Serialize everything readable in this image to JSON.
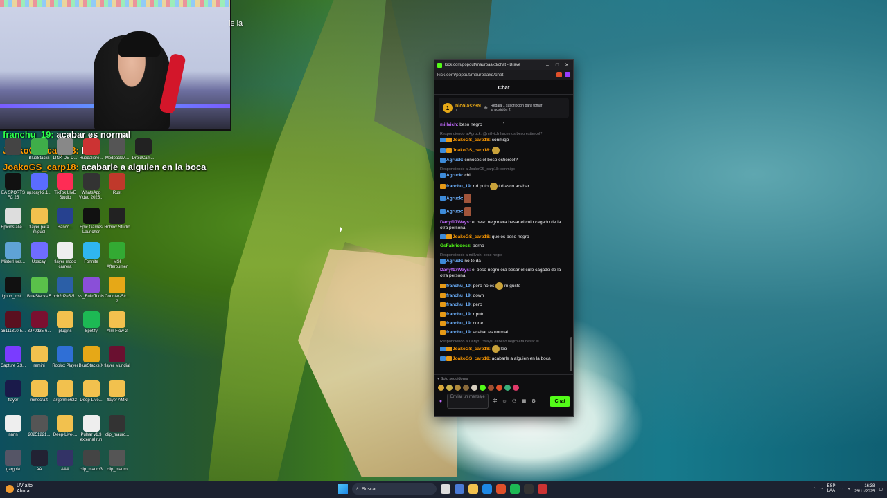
{
  "webcam": {
    "caption_fragment": "le la"
  },
  "overlay_chat": [
    {
      "user": "franchu_19:",
      "text": "acabar es normal",
      "user_color": "#2dff4b"
    },
    {
      "user": "JoakoGS_carp18:",
      "text": "leo",
      "user_color": "#ff9a00"
    },
    {
      "user": "JoakoGS_carp18:",
      "text": "acabarle a alguien en la boca",
      "user_color": "#ff9a00"
    }
  ],
  "desktop_icons": [
    {
      "label": "",
      "icon": "app-icon",
      "color": "#444"
    },
    {
      "label": "BlueStacks",
      "icon": "bluestacks-icon",
      "color": "#3fae49"
    },
    {
      "label": "LINK-DE-D...",
      "icon": "file-icon",
      "color": "#888"
    },
    {
      "label": "Ruedalibre...",
      "icon": "app-icon",
      "color": "#c33"
    },
    {
      "label": "ModpackM...",
      "icon": "app-icon",
      "color": "#555"
    },
    {
      "label": "DroidCam...",
      "icon": "droidcam-icon",
      "color": "#222"
    },
    {
      "label": "EA SPORTS FC 25",
      "icon": "ea-icon",
      "color": "#111"
    },
    {
      "label": "upscayl-2.1...",
      "icon": "upscayl-icon",
      "color": "#5a6cff"
    },
    {
      "label": "TikTok LIVE Studio",
      "icon": "tiktok-icon",
      "color": "#fe2c55"
    },
    {
      "label": "WhatsApp Video 2025...",
      "icon": "video-icon",
      "color": "#333"
    },
    {
      "label": "Rust",
      "icon": "rust-icon",
      "color": "#c0392b"
    },
    {
      "label": "Epicinstalle...",
      "icon": "installer-icon",
      "color": "#ddd"
    },
    {
      "label": "flayer para miguel",
      "icon": "folder-icon",
      "color": "#f2c14e"
    },
    {
      "label": "Banco...",
      "icon": "app-icon",
      "color": "#26418f"
    },
    {
      "label": "Epic Games Launcher",
      "icon": "epic-icon",
      "color": "#111"
    },
    {
      "label": "Roblox Studio",
      "icon": "roblox-icon",
      "color": "#222"
    },
    {
      "label": "MisterHors...",
      "icon": "app-icon",
      "color": "#5fa3d6"
    },
    {
      "label": "Upscayl",
      "icon": "upscayl-icon",
      "color": "#6f6cff"
    },
    {
      "label": "flayer modo carrera",
      "icon": "file-icon",
      "color": "#eee"
    },
    {
      "label": "Fortnite",
      "icon": "fortnite-icon",
      "color": "#2fb6f0"
    },
    {
      "label": "MSI Afterburner",
      "icon": "msi-icon",
      "color": "#3a3"
    },
    {
      "label": "lghub_inst...",
      "icon": "logitech-icon",
      "color": "#111"
    },
    {
      "label": "BlueStacks 5",
      "icon": "bluestacks-icon",
      "color": "#5ac14a"
    },
    {
      "label": "bcb2d2e5-5...",
      "icon": "app-icon",
      "color": "#2b5fa7"
    },
    {
      "label": "vs_BuildTools",
      "icon": "vs-icon",
      "color": "#8a4fd8"
    },
    {
      "label": "Counter-Str... 2",
      "icon": "cs-icon",
      "color": "#e6a817"
    },
    {
      "label": "a6111310-5...",
      "icon": "app-icon",
      "color": "#5a1020"
    },
    {
      "label": "3970d35-6...",
      "icon": "app-icon",
      "color": "#7a1030"
    },
    {
      "label": "plugins",
      "icon": "folder-icon",
      "color": "#f2c14e"
    },
    {
      "label": "Spotify",
      "icon": "spotify-icon",
      "color": "#1db954"
    },
    {
      "label": "Alm Flow 2",
      "icon": "folder-icon",
      "color": "#f2c14e"
    },
    {
      "label": "Capture 5.3...",
      "icon": "capture-icon",
      "color": "#7a3cff"
    },
    {
      "label": "remini",
      "icon": "folder-icon",
      "color": "#f2c14e"
    },
    {
      "label": "Roblox Player",
      "icon": "roblox-icon",
      "color": "#2f6fd6"
    },
    {
      "label": "BlueStacks X",
      "icon": "bluestacks-icon",
      "color": "#e6a817"
    },
    {
      "label": "flayer Mundial",
      "icon": "app-icon",
      "color": "#6a1030"
    },
    {
      "label": "flayer",
      "icon": "ae-icon",
      "color": "#1a1a4a"
    },
    {
      "label": "minecraft",
      "icon": "folder-icon",
      "color": "#f2c14e"
    },
    {
      "label": "argenmo622",
      "icon": "folder-icon",
      "color": "#f2c14e"
    },
    {
      "label": "Deep-Live...",
      "icon": "folder-icon",
      "color": "#f2c14e"
    },
    {
      "label": "flayer AMN",
      "icon": "folder-icon",
      "color": "#f2c14e"
    },
    {
      "label": "nnnn",
      "icon": "file-icon",
      "color": "#eee"
    },
    {
      "label": "20251221...",
      "icon": "app-icon",
      "color": "#555"
    },
    {
      "label": "Deep-Live-...",
      "icon": "folder-icon",
      "color": "#f2c14e"
    },
    {
      "label": "Pulsar v1.3 external run",
      "icon": "file-icon",
      "color": "#eee"
    },
    {
      "label": "clip_mauro...",
      "icon": "app-icon",
      "color": "#333"
    },
    {
      "label": "gargola",
      "icon": "app-icon",
      "color": "#556"
    },
    {
      "label": "AA",
      "icon": "app-icon",
      "color": "#223"
    },
    {
      "label": "AAA",
      "icon": "app-icon",
      "color": "#336"
    },
    {
      "label": "clip_mauro3",
      "icon": "app-icon",
      "color": "#444"
    },
    {
      "label": "clip_mauro",
      "icon": "app-icon",
      "color": "#555"
    }
  ],
  "chat_window": {
    "title": "kick.com/popout/mauroaakd/chat - Brave",
    "url": "kick.com/popout/mauroaakd/chat",
    "header": "Chat",
    "pinned": {
      "user": "nicolas23N",
      "sub": "1",
      "rank": "1",
      "gift_text": "Regala 1 suscripción para tomar la posición 2"
    },
    "messages": [
      {
        "reply": "",
        "user": "millvich:",
        "color": "#c36bff",
        "badges": [],
        "text": "beso negro"
      },
      {
        "reply": "Respondiendo a Agruck: @millvich hacemos beso estiercol?",
        "user": "JoakoGS_carp18:",
        "color": "#ff9a00",
        "badges": [
          "b",
          "o"
        ],
        "text": "conmigo"
      },
      {
        "reply": "",
        "user": "JoakoGS_carp18:",
        "color": "#ff9a00",
        "badges": [
          "b",
          "o"
        ],
        "text": "",
        "emote": "emote"
      },
      {
        "reply": "",
        "user": "Agruck:",
        "color": "#6fb3ff",
        "badges": [
          "b"
        ],
        "text": "conoces el beso estiercol?"
      },
      {
        "reply": "Respondiendo a JoakoGS_carp18: conmigo",
        "user": "Agruck:",
        "color": "#6fb3ff",
        "badges": [
          "b"
        ],
        "text": "chi"
      },
      {
        "reply": "",
        "user": "franchu_19:",
        "color": "#6fb3ff",
        "badges": [
          "o"
        ],
        "text": "r d puto",
        "emote": "emote",
        "text2": "t d asco acabar"
      },
      {
        "reply": "",
        "user": "Agruck:",
        "color": "#6fb3ff",
        "badges": [
          "b"
        ],
        "text": "",
        "emote": "big"
      },
      {
        "reply": "",
        "user": "Agruck:",
        "color": "#6fb3ff",
        "badges": [
          "b"
        ],
        "text": "",
        "emote": "big"
      },
      {
        "reply": "",
        "user": "Danyf17Ways:",
        "color": "#c36bff",
        "badges": [],
        "text": "el beso negro era besar el culo cagado de la otra persona"
      },
      {
        "reply": "",
        "user": "JoakoGS_carp18:",
        "color": "#ff9a00",
        "badges": [
          "b",
          "o"
        ],
        "text": "que es beso negro"
      },
      {
        "reply": "",
        "user": "GsFabricoosz:",
        "color": "#53fc18",
        "badges": [],
        "text": "porno"
      },
      {
        "reply": "Respondiendo a millvich: beso negro",
        "user": "Agruck:",
        "color": "#6fb3ff",
        "badges": [
          "b"
        ],
        "text": "no te da"
      },
      {
        "reply": "",
        "user": "Danyf17Ways:",
        "color": "#c36bff",
        "badges": [],
        "text": "el beso negro era besar el culo cagado de la otra persona"
      },
      {
        "reply": "",
        "user": "franchu_19:",
        "color": "#6fb3ff",
        "badges": [
          "o"
        ],
        "text": "pero no es",
        "emote": "emote",
        "text2": "m guste"
      },
      {
        "reply": "",
        "user": "franchu_19:",
        "color": "#6fb3ff",
        "badges": [
          "o"
        ],
        "text": "down"
      },
      {
        "reply": "",
        "user": "franchu_19:",
        "color": "#6fb3ff",
        "badges": [
          "o"
        ],
        "text": "pero"
      },
      {
        "reply": "",
        "user": "franchu_19:",
        "color": "#6fb3ff",
        "badges": [
          "o"
        ],
        "text": "r puto"
      },
      {
        "reply": "",
        "user": "franchu_19:",
        "color": "#6fb3ff",
        "badges": [
          "o"
        ],
        "text": "corte"
      },
      {
        "reply": "",
        "user": "franchu_19:",
        "color": "#6fb3ff",
        "badges": [
          "o"
        ],
        "text": "acabar es normal"
      },
      {
        "reply": "Respondiendo a Danyf17Ways: el beso negro era besar el ...",
        "user": "JoakoGS_carp18:",
        "color": "#ff9a00",
        "badges": [
          "b",
          "o"
        ],
        "text": "",
        "emote": "emote",
        "text2": "leo"
      },
      {
        "reply": "",
        "user": "JoakoGS_carp18:",
        "color": "#ff9a00",
        "badges": [
          "b",
          "o"
        ],
        "text": "acabarle a alguien en la boca"
      }
    ],
    "followers_only": "Solo seguidores",
    "input_placeholder": "Enviar un mensaje",
    "send_label": "Chat"
  },
  "taskbar": {
    "weather_title": "UV alto",
    "weather_sub": "Ahora",
    "search_placeholder": "Buscar",
    "lang_1": "ESP",
    "lang_2": "LAA",
    "time": "16:38",
    "date": "28/11/2025"
  }
}
